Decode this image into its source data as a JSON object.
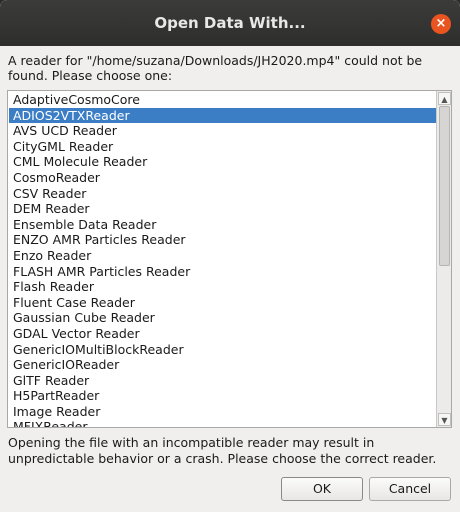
{
  "dialog": {
    "title": "Open Data With...",
    "close_symbol": "×",
    "prompt": "A reader for \"/home/suzana/Downloads/JH2020.mp4\" could not be found. Please choose one:",
    "warning": "Opening the file with an incompatible reader may result in unpredictable behavior or a crash.  Please choose the correct reader.",
    "ok_label": "OK",
    "cancel_label": "Cancel"
  },
  "readers": {
    "selected_index": 1,
    "items": [
      "AdaptiveCosmoCore",
      "ADIOS2VTXReader",
      "AVS UCD Reader",
      "CityGML Reader",
      "CML Molecule Reader",
      "CosmoReader",
      "CSV Reader",
      "DEM Reader",
      "Ensemble Data Reader",
      "ENZO AMR Particles Reader",
      "Enzo Reader",
      "FLASH AMR Particles Reader",
      "Flash Reader",
      "Fluent Case Reader",
      "Gaussian Cube Reader",
      "GDAL Vector Reader",
      "GenericIOMultiBlockReader",
      "GenericIOReader",
      "GlTF Reader",
      "H5PartReader",
      "Image Reader",
      "MFIXReader"
    ]
  },
  "icons": {
    "close": "close-icon",
    "scroll_up": "chevron-up-icon",
    "scroll_down": "chevron-down-icon"
  },
  "colors": {
    "titlebar": "#2e2e2c",
    "close_button": "#e95420",
    "selection": "#3b7ec6",
    "dialog_bg": "#f0efee"
  }
}
